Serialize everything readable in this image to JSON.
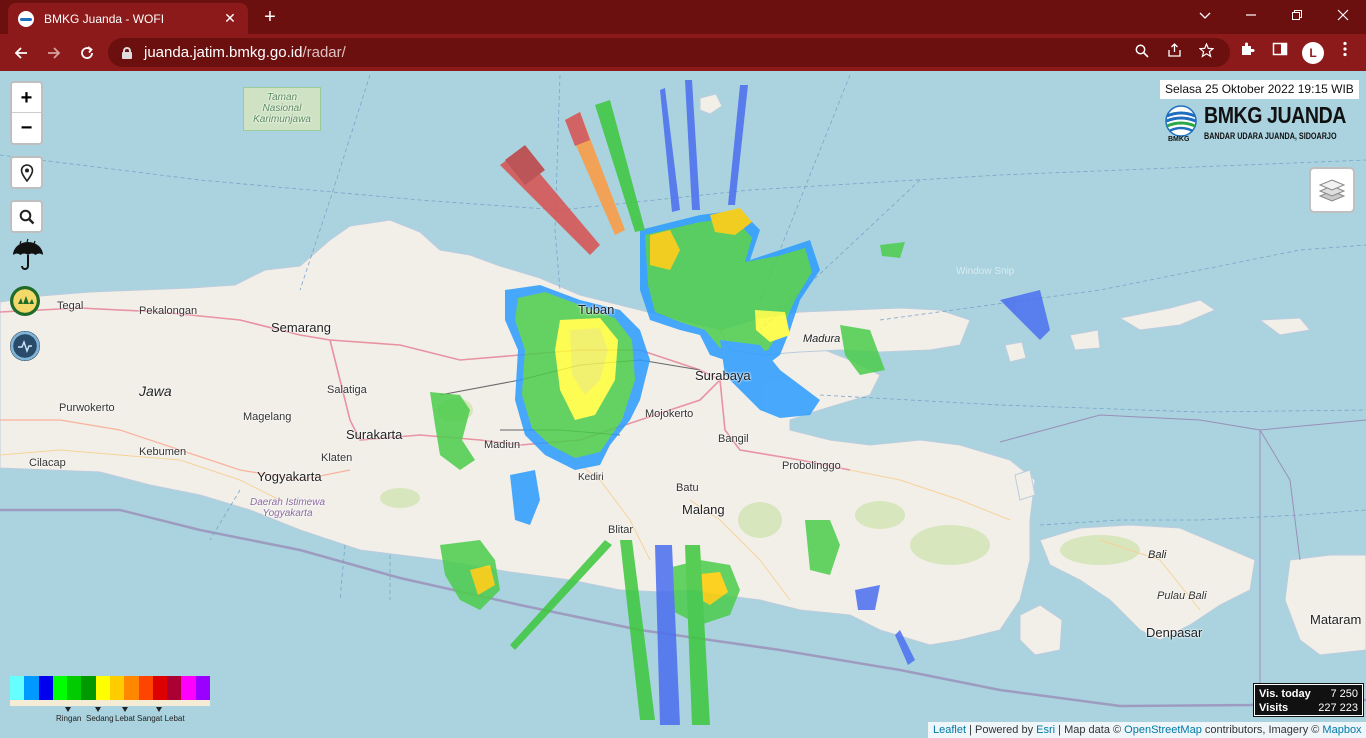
{
  "browser": {
    "tab_title": "BMKG Juanda - WOFI",
    "tab_close": "✕",
    "new_tab": "+",
    "url_domain": "juanda.jatim.bmkg.go.id",
    "url_path": "/radar/",
    "profile_initial": "L"
  },
  "map": {
    "zoom_in": "+",
    "zoom_out": "−",
    "timestamp": "Selasa 25 Oktober 2022 19:15 WIB",
    "brand_name": "BMKG JUANDA",
    "brand_sub": "BANDAR UDARA JUANDA, SIDOARJO",
    "brand_logo_text": "BMKG",
    "watermark": "Window Snip",
    "places": {
      "tegal": "Tegal",
      "pekalongan": "Pekalongan",
      "semarang": "Semarang",
      "jawa": "Jawa",
      "purwokerto": "Purwokerto",
      "salatiga": "Salatiga",
      "magelang": "Magelang",
      "surakarta": "Surakarta",
      "kebumen": "Kebumen",
      "cilacap": "Cilacap",
      "yogyakarta": "Yogyakarta",
      "diy_line1": "Daerah Istimewa",
      "diy_line2": "Yogyakarta",
      "klaten": "Klaten",
      "madiun": "Madiun",
      "tuban": "Tuban",
      "surabaya": "Surabaya",
      "madura": "Madura",
      "mojokerto": "Mojokerto",
      "bangil": "Bangil",
      "kediri": "Kediri",
      "batu": "Batu",
      "malang": "Malang",
      "blitar": "Blitar",
      "probolinggo": "Probolinggo",
      "bali": "Bali",
      "pulau_bali": "Pulau Bali",
      "denpasar": "Denpasar",
      "mataram": "Mataram",
      "taman_line1": "Taman",
      "taman_line2": "Nasional",
      "taman_line3": "Karimunjawa"
    }
  },
  "legend": {
    "colors": [
      "#66ffff",
      "#0099ff",
      "#0000ee",
      "#00ff00",
      "#00cc00",
      "#009900",
      "#ffff00",
      "#ffcc00",
      "#ff8800",
      "#ff4400",
      "#dd0000",
      "#aa0033",
      "#ff00ff",
      "#9900ff"
    ],
    "labels": [
      "Ringan",
      "Sedang",
      "Lebat",
      "Sangat Lebat"
    ]
  },
  "visits": {
    "today_label": "Vis. today",
    "today_value": "7 250",
    "total_label": "Visits",
    "total_value": "227 223"
  },
  "attribution": {
    "leaflet": "Leaflet",
    "sep1": " | Powered by ",
    "esri": "Esri",
    "sep2": " | Map data © ",
    "osm": "OpenStreetMap",
    "sep3": " contributors, Imagery © ",
    "mapbox": "Mapbox"
  }
}
